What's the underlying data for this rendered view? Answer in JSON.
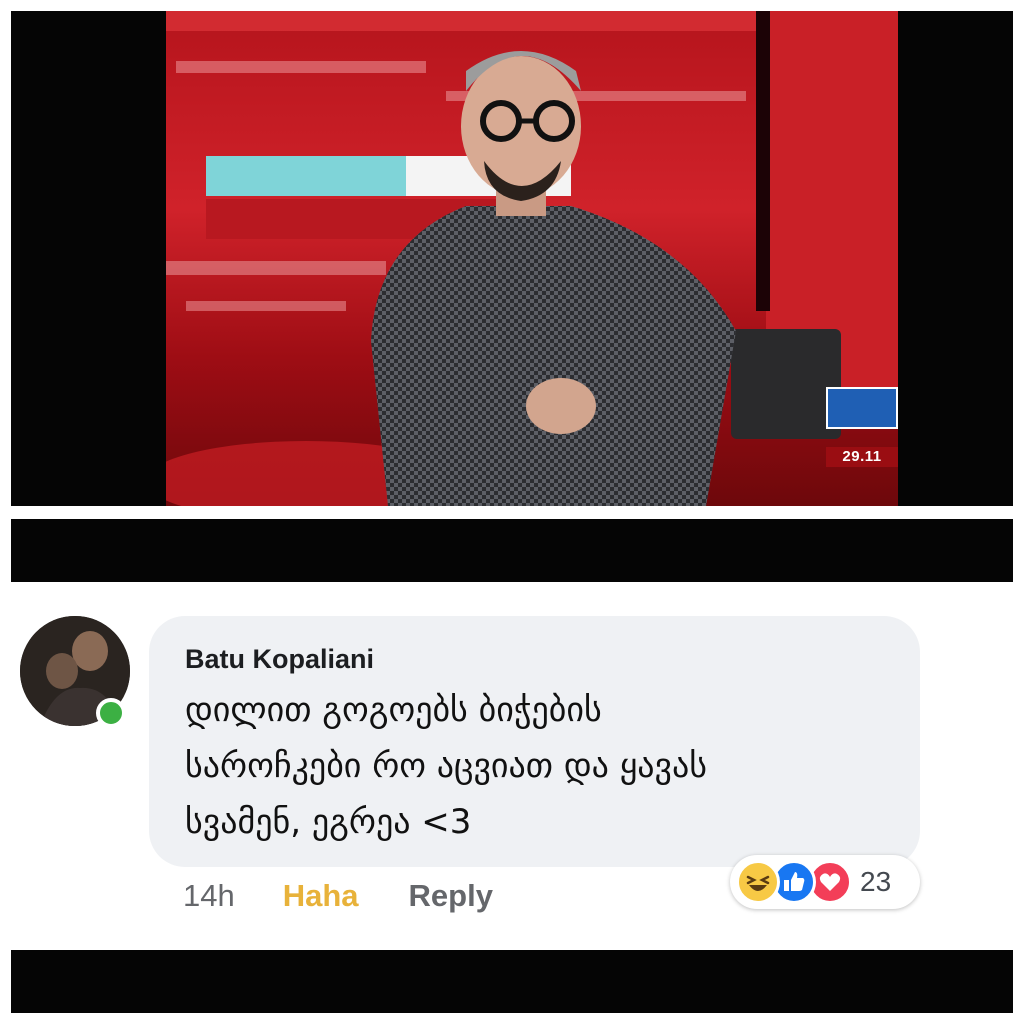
{
  "video": {
    "date_bug": "29.11"
  },
  "comment": {
    "author": "Batu Kopaliani",
    "text": "დილით გოგოებს ბიჭების\nსაროჩკები რო აცვიათ და ყავას\nსვამენ, ეგრეა <3",
    "timestamp": "14h",
    "user_reaction_label": "Haha",
    "reply_label": "Reply",
    "reactions": {
      "icons": [
        "haha-icon",
        "like-icon",
        "love-icon"
      ],
      "count": "23"
    },
    "online_status_color": "#3cb043"
  },
  "colors": {
    "haha_accent": "#e8b23a",
    "like_blue": "#1877f2",
    "love_red": "#f33e58",
    "bubble_bg": "#eff1f4"
  }
}
